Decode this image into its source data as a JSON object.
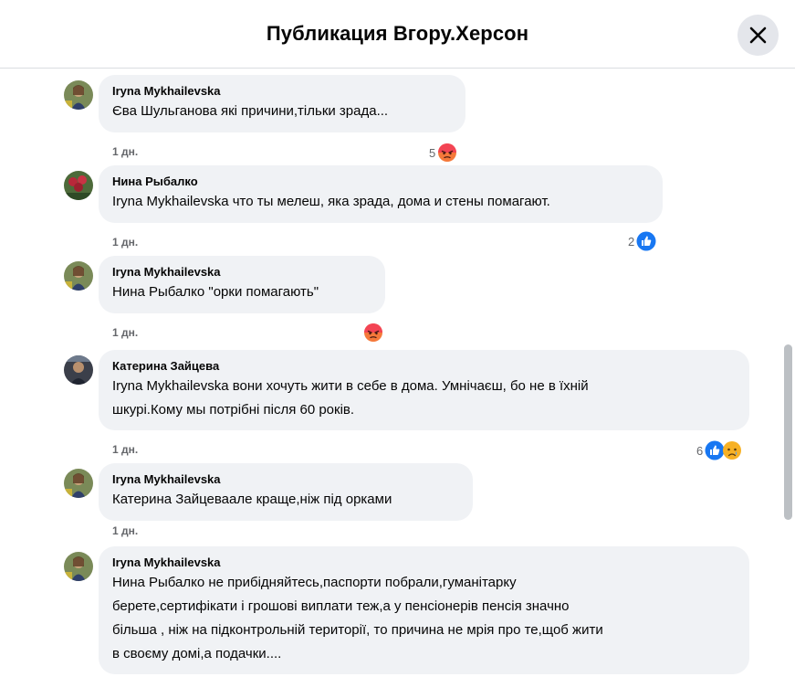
{
  "header": {
    "title": "Публикация Вгору.Херсон"
  },
  "colors": {
    "bubble": "#f0f2f5",
    "like": "#1877f2",
    "angry": "#f33e58",
    "meta": "#65676b"
  },
  "comments": [
    {
      "author": "Iryna Mykhailevska",
      "text": "Єва Шульганова які причини,тільки зрада...",
      "time": "1 дн.",
      "reaction_count": "5",
      "reactions": [
        "angry-icon"
      ]
    },
    {
      "author": "Нина Рыбалко",
      "text": "Iryna Mykhailevska что ты мелеш, яка зрада, дома и стены помагают.",
      "time": "1 дн.",
      "reaction_count": "2",
      "reactions": [
        "like-icon"
      ]
    },
    {
      "author": "Iryna Mykhailevska",
      "text": "Нина Рыбалко \"орки помагають\"",
      "time": "1 дн.",
      "reaction_count": "",
      "reactions": [
        "angry-icon"
      ]
    },
    {
      "author": "Катерина Зайцева",
      "text_lines": [
        "Iryna Mykhailevska вони хочуть жити в себе в дома. Умнічаєш, бо не в їхній",
        "шкурі.Кому мы потрібні після 60 років."
      ],
      "time": "1 дн.",
      "reaction_count": "6",
      "reactions": [
        "like-icon",
        "sad-icon"
      ]
    },
    {
      "author": "Iryna Mykhailevska",
      "text": "Катерина Зайцеваале краще,ніж під орками",
      "time": "1 дн.",
      "reaction_count": "",
      "reactions": []
    },
    {
      "author": "Iryna Mykhailevska",
      "text_lines": [
        "Нина Рыбалко не прибідняйтесь,паспорти побрали,гуманітарку",
        "берете,сертифікати і грошові виплати теж,а у пенсіонерів пенсія значно",
        "більша , ніж на підконтрольній території, то причина не мрія про те,щоб жити",
        "в своєму домі,а подачки...."
      ],
      "time": "",
      "reaction_count": "",
      "reactions": []
    }
  ]
}
